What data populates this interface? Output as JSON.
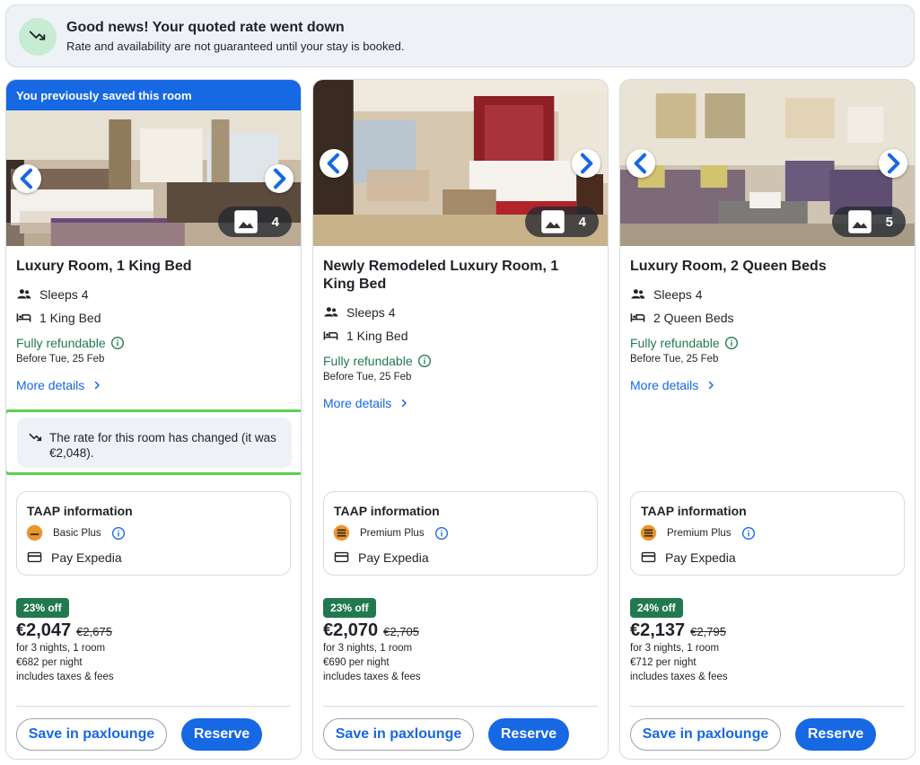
{
  "banner": {
    "title": "Good news! Your quoted rate went down",
    "subtitle": "Rate and availability are not guaranteed until your stay is booked."
  },
  "colors": {
    "accent": "#1668e3",
    "refund_green": "#227950",
    "highlight_border": "#5ad24f"
  },
  "cards": [
    {
      "saved_label": "You previously saved this room",
      "photo_count": "4",
      "title": "Luxury Room, 1 King Bed",
      "sleeps": "Sleeps 4",
      "beds": "1 King Bed",
      "refund": "Fully refundable",
      "refund_date": "Before Tue, 25 Feb",
      "more_details": "More details",
      "rate_change": "The rate for this room has changed (it was €2,048).",
      "taap_title": "TAAP information",
      "taap_tier": "Basic Plus",
      "taap_pay": "Pay Expedia",
      "discount": "23% off",
      "price": "€2,047",
      "old_price": "€2,675",
      "nights": "for 3 nights, 1 room",
      "per_night": "€682 per night",
      "taxes": "includes taxes & fees",
      "save_label": "Save in paxlounge",
      "reserve_label": "Reserve"
    },
    {
      "photo_count": "4",
      "title": "Newly Remodeled Luxury Room, 1 King Bed",
      "sleeps": "Sleeps 4",
      "beds": "1 King Bed",
      "refund": "Fully refundable",
      "refund_date": "Before Tue, 25 Feb",
      "more_details": "More details",
      "taap_title": "TAAP information",
      "taap_tier": "Premium Plus",
      "taap_pay": "Pay Expedia",
      "discount": "23% off",
      "price": "€2,070",
      "old_price": "€2,705",
      "nights": "for 3 nights, 1 room",
      "per_night": "€690 per night",
      "taxes": "includes taxes & fees",
      "save_label": "Save in paxlounge",
      "reserve_label": "Reserve"
    },
    {
      "photo_count": "5",
      "title": "Luxury Room, 2 Queen Beds",
      "sleeps": "Sleeps 4",
      "beds": "2 Queen Beds",
      "refund": "Fully refundable",
      "refund_date": "Before Tue, 25 Feb",
      "more_details": "More details",
      "taap_title": "TAAP information",
      "taap_tier": "Premium Plus",
      "taap_pay": "Pay Expedia",
      "discount": "24% off",
      "price": "€2,137",
      "old_price": "€2,795",
      "nights": "for 3 nights, 1 room",
      "per_night": "€712 per night",
      "taxes": "includes taxes & fees",
      "save_label": "Save in paxlounge",
      "reserve_label": "Reserve"
    }
  ]
}
